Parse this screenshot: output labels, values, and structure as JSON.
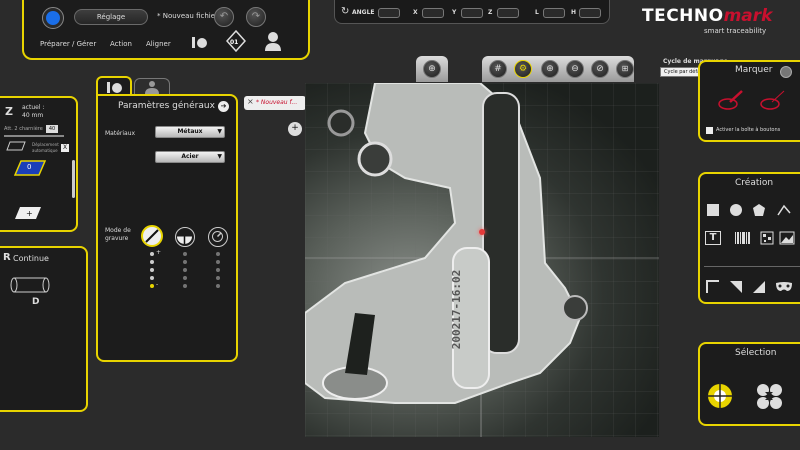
{
  "toolbar": {
    "reglage_label": "Réglage",
    "new_file_label": "* Nouveau fichier",
    "preparer_label": "Préparer / Gérer",
    "action_label": "Action",
    "aligner_label": "Aligner",
    "counter_badge": "01"
  },
  "coords": {
    "angle_label": "ANGLE",
    "x_label": "X",
    "y_label": "Y",
    "z_label": "Z",
    "l_label": "L",
    "h_label": "H"
  },
  "brand": {
    "logo_bold": "TECHNO",
    "logo_italic": "mark",
    "tagline": "smart traceability"
  },
  "z_panel": {
    "z_letter": "Z",
    "actual_label": "actuel :",
    "actual_value": "40 mm",
    "field_label": "Att. 2 charnière",
    "field_value": "40",
    "deplacement_label": "Déplacement automatique",
    "deplacement_check": "X",
    "zero_label": "0"
  },
  "continue_panel": {
    "r_letter": "R",
    "title": "Continue",
    "d_label": "D"
  },
  "params_panel": {
    "title": "Paramètres généraux",
    "materiaux_label": "Matériaux",
    "material_value": "Métaux",
    "submaterial_value": "Acier",
    "mode_label_1": "Mode de",
    "mode_label_2": "gravure",
    "plus_label": "+",
    "minus_label": "-"
  },
  "file_tab": {
    "label": "* Nouveau f..."
  },
  "image_area": {
    "engraved_text": "200217-16:02"
  },
  "cycle": {
    "title": "Cycle de marquage",
    "value": "Cycle par défaut"
  },
  "marquer_panel": {
    "title": "Marquer",
    "checkbox_label": "Activer la boîte à boutons"
  },
  "creation_panel": {
    "title": "Création"
  },
  "selection_panel": {
    "title": "Sélection"
  },
  "colors": {
    "accent": "#e8d400",
    "brand_red": "#c8102e",
    "background": "#2b2b2b"
  }
}
